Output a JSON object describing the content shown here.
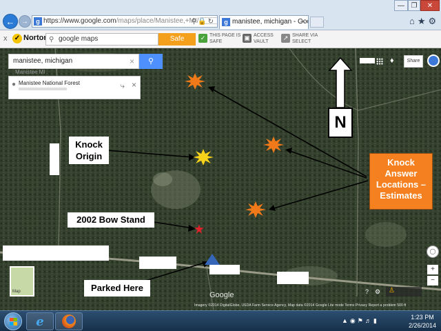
{
  "browser": {
    "url_prefix": "https://",
    "url_host": "www.google.com",
    "url_path": "/maps/place/Manistee,+MI/",
    "tab_title": "manistee, michigan - Goog...",
    "tab_favicon": "g",
    "window_controls": {
      "minimize": "—",
      "maximize": "❐",
      "close": "✕"
    }
  },
  "toolbar": {
    "close_label": "x",
    "norton_label": "Norton",
    "search_value": "google maps",
    "safe_search_label": "Safe Search",
    "page_safe_line1": "THIS PAGE IS",
    "page_safe_line2": "SAFE",
    "vault_line1": "ACCESS",
    "vault_line2": "VAULT",
    "share_line1": "SHARE VIA",
    "share_line2": "SELECT"
  },
  "map": {
    "search_value": "manistee, michigan",
    "under_search_text": "Manistee MI",
    "place_card_name": "Manistee National Forest",
    "share_label": "Share",
    "thumbnail_label": "Map",
    "google_logo": "Google",
    "attribution": "Imagery ©2014 DigitalGlobe, USDA Farm Service Agency, Map data ©2014 Google    Lite mode    Terms    Privacy    Report a problem    500 ft",
    "zoom_in": "+",
    "zoom_out": "−"
  },
  "annotations": {
    "knock_origin": [
      "Knock",
      "Origin"
    ],
    "bow_stand": "2002 Bow Stand",
    "parked_here": "Parked Here",
    "answer_locations": [
      "Knock",
      "Answer",
      "Locations –",
      "Estimates"
    ],
    "north": "N"
  },
  "colors": {
    "answer_burst": "#f07a1a",
    "origin_burst": "#f7d21a",
    "bow_stand_marker": "#e0202a",
    "parked_marker": "#3566b8",
    "answer_box": "#f5801f"
  },
  "taskbar": {
    "clock_time": "1:23 PM",
    "clock_date": "2/26/2014"
  }
}
